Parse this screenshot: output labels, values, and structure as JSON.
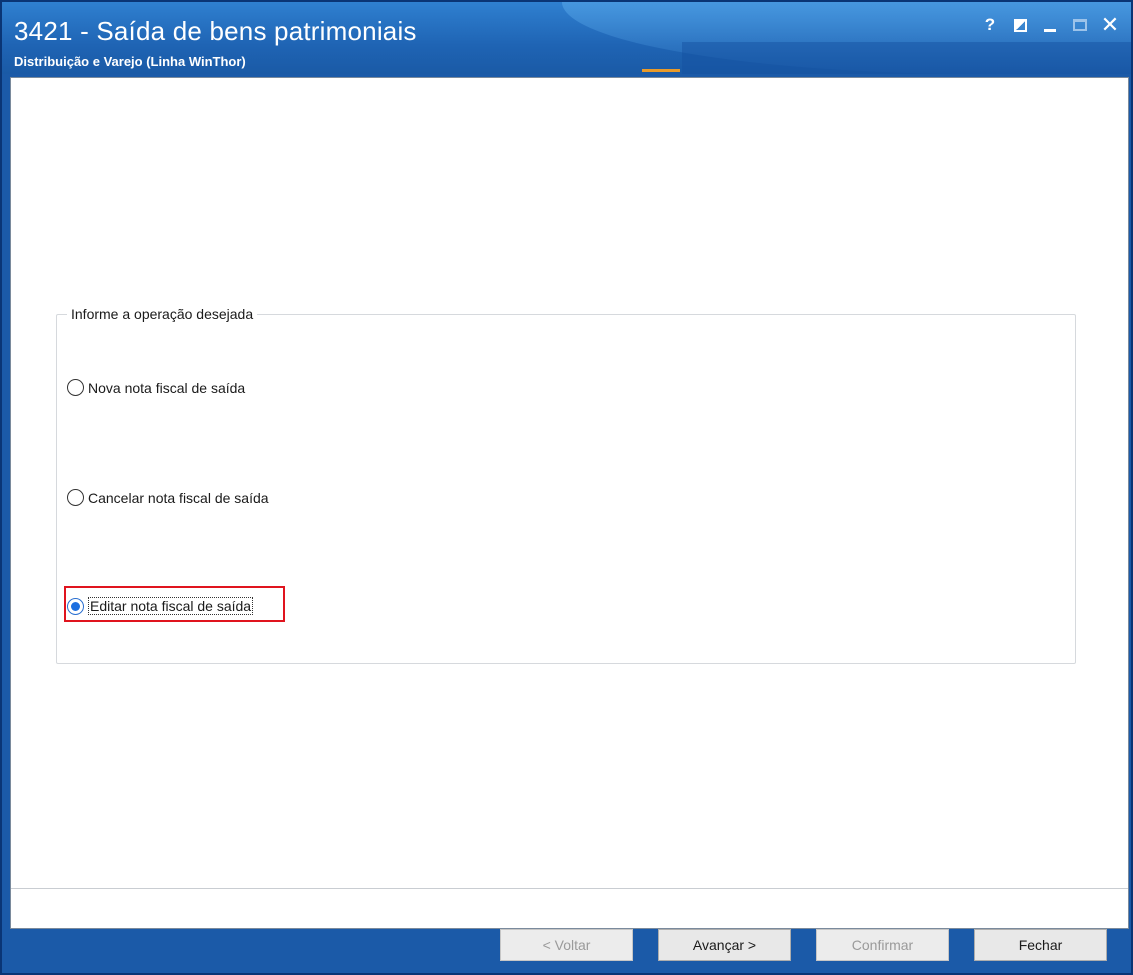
{
  "window": {
    "title": "3421 - Saída de bens patrimoniais",
    "subtitle": "Distribuição e Varejo (Linha WinThor)",
    "controls": {
      "help": "?",
      "close": "✕"
    }
  },
  "group": {
    "legend": "Informe a operação desejada",
    "options": [
      {
        "label": "Nova nota fiscal de saída",
        "selected": false
      },
      {
        "label": "Cancelar nota fiscal de saída",
        "selected": false
      },
      {
        "label": "Editar nota fiscal de saída",
        "selected": true
      }
    ]
  },
  "buttons": {
    "back": "< Voltar",
    "next": "Avançar >",
    "confirm": "Confirmar",
    "close": "Fechar"
  },
  "colors": {
    "titlebar": "#1f64b4",
    "highlight": "#e0141e",
    "accent": "#e89a2a"
  }
}
